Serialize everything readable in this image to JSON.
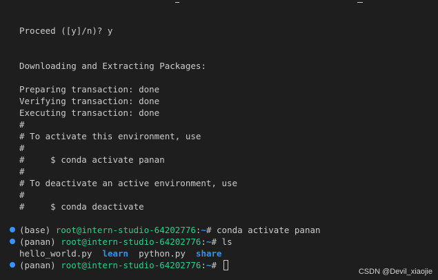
{
  "terminal": {
    "lines": [
      "Proceed ([y]/n)? y",
      "Downloading and Extracting Packages:",
      "Preparing transaction: done",
      "Verifying transaction: done",
      "Executing transaction: done",
      "#",
      "# To activate this environment, use",
      "#",
      "#     $ conda activate panan",
      "#",
      "# To deactivate an active environment, use",
      "#",
      "#     $ conda deactivate"
    ],
    "prompts": [
      {
        "env": "(base) ",
        "userhost": "root@intern-studio-64202776",
        "sep": ":",
        "path": "~",
        "symbol": "# ",
        "command": "conda activate panan"
      },
      {
        "env": "(panan) ",
        "userhost": "root@intern-studio-64202776",
        "sep": ":",
        "path": "~",
        "symbol": "# ",
        "command": "ls"
      },
      {
        "env": "(panan) ",
        "userhost": "root@intern-studio-64202776",
        "sep": ":",
        "path": "~",
        "symbol": "# ",
        "command": ""
      }
    ],
    "ls_output": {
      "file1": "hello_world.py",
      "dir1": "learn",
      "file2": "python.py",
      "dir2": "share"
    }
  },
  "watermark": "CSDN @Devil_xiaojie",
  "colors": {
    "background": "#1e1e1e",
    "text": "#cccccc",
    "prompt_green": "#23d18b",
    "directory_blue": "#3b8eea",
    "decoration_dot": "#3794ff"
  }
}
